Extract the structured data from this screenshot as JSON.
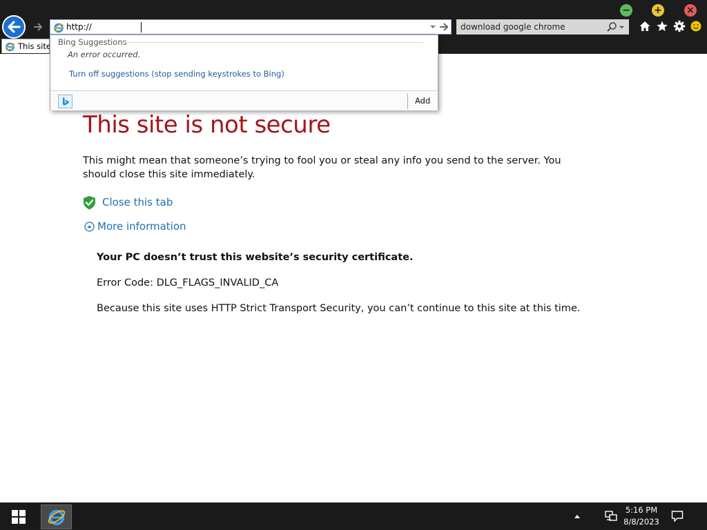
{
  "browser": {
    "address": {
      "value": "http://",
      "placeholder": ""
    },
    "search": {
      "value": "download google chrome"
    },
    "tab": {
      "label": "This site is not secure"
    },
    "icons": {
      "back": "back-arrow-icon",
      "forward": "forward-arrow-icon",
      "home": "home-icon",
      "favorites": "star-icon",
      "tools": "gear-icon",
      "feedback": "smiley-icon"
    },
    "window_buttons": {
      "minimize": "−",
      "maximize": "+",
      "close": "×"
    },
    "colors": {
      "minimize": "#5cbb5c",
      "maximize": "#e8c43a",
      "close": "#e35a5a",
      "back": "#1b6fd1"
    }
  },
  "suggestions": {
    "header": "Bing Suggestions",
    "error": "An error occurred.",
    "turn_off": "Turn off suggestions (stop sending keystrokes to Bing)",
    "add": "Add"
  },
  "page": {
    "title": "This site is not secure",
    "description": "This might mean that someone’s trying to fool you or steal any info you send to the server. You should close this site immediately.",
    "close_tab": "Close this tab",
    "more_info": "More information",
    "cert_message": "Your PC doesn’t trust this website’s security certificate.",
    "error_code": "Error Code: DLG_FLAGS_INVALID_CA",
    "hsts_message": "Because this site uses HTTP Strict Transport Security, you can’t continue to this site at this time.",
    "colors": {
      "title": "#a2161b",
      "link": "#1e6fb6"
    }
  },
  "taskbar": {
    "time": "5:16 PM",
    "date": "8/8/2023"
  }
}
